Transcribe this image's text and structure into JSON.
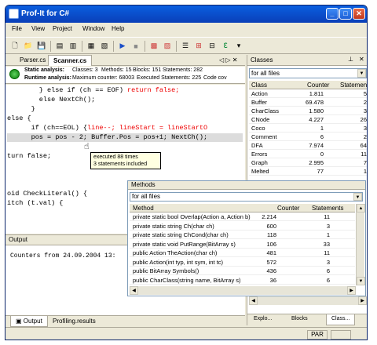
{
  "window": {
    "title": "Prof-It for C#"
  },
  "menu": [
    "File",
    "View",
    "Project",
    "Window",
    "Help"
  ],
  "editor": {
    "tabs": [
      "Parser.cs",
      "Scanner.cs"
    ],
    "static_label": "Static analysis:",
    "static_stats": [
      "Classes: 3",
      "Methods: 15",
      "Blocks: 151",
      "Statements: 282"
    ],
    "runtime_label": "Runtime analysis:",
    "runtime_stats": [
      "Maximum counter: 68003",
      "Executed Statements: 225",
      "Code cov"
    ],
    "code": [
      "        } else if (ch == EOF) ",
      "        else NextCh();",
      "      }",
      "else {",
      "      if (ch==EOL) {",
      "      pos = pos - 2; Buffer.Pos = pos+1; NextCh();",
      "",
      "turn false;",
      "",
      "",
      "oid CheckLiteral() {",
      "itch (t.val) {"
    ],
    "code_red": {
      "line0": "return false;",
      "line4": "line--; lineStart = lineStartO"
    },
    "tooltip": [
      "executed 88 times",
      "3 statements included"
    ]
  },
  "output": {
    "title": "Output",
    "text": "Counters from 24.09.2004 13:",
    "tabs": [
      "Output",
      "Profiling.results"
    ]
  },
  "classes": {
    "title": "Classes",
    "filter": "for all files",
    "columns": [
      "Class",
      "Counter",
      "Statement"
    ],
    "rows": [
      [
        "Action",
        "1.811",
        "5"
      ],
      [
        "Buffer",
        "69.478",
        "2"
      ],
      [
        "CharClass",
        "1.580",
        "3"
      ],
      [
        "CNode",
        "4.227",
        "26"
      ],
      [
        "Coco",
        "1",
        "3"
      ],
      [
        "Comment",
        "6",
        "2"
      ],
      [
        "DFA",
        "7.974",
        "64"
      ],
      [
        "Errors",
        "0",
        "11"
      ],
      [
        "Graph",
        "2.995",
        "7"
      ],
      [
        "Melted",
        "77",
        "1"
      ]
    ],
    "bottom_tabs": [
      "Explo...",
      "Blocks",
      "Class..."
    ]
  },
  "methods": {
    "title": "Methods",
    "filter": "for all files",
    "columns": [
      "Method",
      "Counter",
      "Statements"
    ],
    "rows": [
      [
        "private static bool Overlap(Action a, Action b)",
        "2.214",
        "11"
      ],
      [
        "private static string Ch(char ch)",
        "600",
        "3"
      ],
      [
        "private static string ChCond(char ch)",
        "118",
        "1"
      ],
      [
        "private static void PutRange(BitArray s)",
        "106",
        "33"
      ],
      [
        "public Action TheAction(char ch)",
        "481",
        "11"
      ],
      [
        "public Action(int typ, int sym, int tc)",
        "572",
        "3"
      ],
      [
        "public BitArray Symbols()",
        "436",
        "6"
      ],
      [
        "public CharClass(string name, BitArray s)",
        "36",
        "6"
      ]
    ]
  },
  "status": {
    "par": "PAR"
  },
  "colors": {
    "title_bar": "#0a4fd0",
    "selection": "#3d6fd2",
    "tooltip_bg": "#ffffe1"
  }
}
